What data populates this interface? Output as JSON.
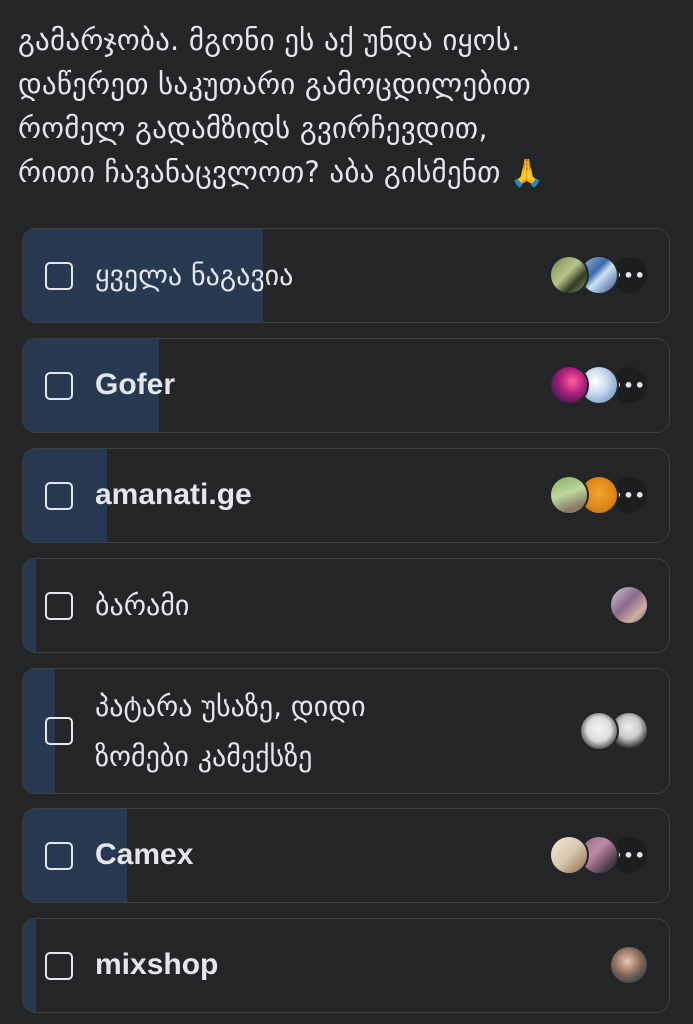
{
  "post": {
    "lines": [
      "გამარჯობა. მგონი ეს აქ უნდა იყოს.",
      "დაწერეთ საკუთარი გამოცდილებით",
      "რომელ გადამზიდს გვირჩევდით,",
      "რითი ჩავანაცვლოთ? აბა გისმენთ"
    ],
    "emoji": "🙏"
  },
  "colors": {
    "background": "#242526",
    "option_border": "#3e4042",
    "vote_fill": "#263951",
    "text": "#e4e6eb"
  },
  "options": [
    {
      "label": "ყველა ნაგავია",
      "vote_share": 0.37,
      "avatars": [
        "avatar-photo",
        "avatar-photo",
        "more-voters-icon"
      ],
      "more_symbol": "•••"
    },
    {
      "label": "Gofer",
      "vote_share": 0.21,
      "avatars": [
        "avatar-photo",
        "avatar-photo",
        "more-voters-icon"
      ],
      "more_symbol": "•••"
    },
    {
      "label": "amanati.ge",
      "vote_share": 0.13,
      "avatars": [
        "avatar-photo",
        "avatar-photo",
        "more-voters-icon"
      ],
      "more_symbol": "•••"
    },
    {
      "label": "ბარამი",
      "vote_share": 0.02,
      "avatars": [
        "avatar-photo"
      ]
    },
    {
      "label_lines": [
        "პატარა უსაზე, დიდი",
        "ზომები კამექსზე"
      ],
      "vote_share": 0.05,
      "avatars": [
        "avatar-photo",
        "avatar-photo"
      ]
    },
    {
      "label": "Camex",
      "vote_share": 0.16,
      "avatars": [
        "avatar-photo",
        "avatar-photo",
        "more-voters-icon"
      ],
      "more_symbol": "•••"
    },
    {
      "label": "mixshop",
      "vote_share": 0.02,
      "avatars": [
        "avatar-photo"
      ]
    }
  ]
}
